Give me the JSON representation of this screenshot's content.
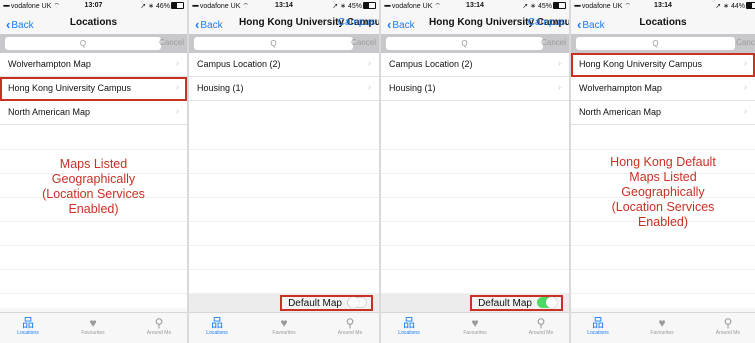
{
  "status_bar": {
    "carrier": "vodafone UK",
    "panels": [
      {
        "time": "13:07",
        "battery": "46%",
        "battery_level": 0.46
      },
      {
        "time": "13:14",
        "battery": "45%",
        "battery_level": 0.45
      },
      {
        "time": "13:14",
        "battery": "45%",
        "battery_level": 0.45
      },
      {
        "time": "13:14",
        "battery": "44%",
        "battery_level": 0.44
      }
    ]
  },
  "nav": {
    "back_label": "Back",
    "locations_title": "Locations",
    "campus_title": "Hong Kong University Campus",
    "campus_right": "Campus"
  },
  "search": {
    "placeholder": "Q",
    "cancel_label": "Cancel"
  },
  "lists": {
    "panel1": [
      "Wolverhampton Map",
      "Hong Kong University Campus",
      "North American Map"
    ],
    "panel2": [
      "Campus Location (2)",
      "Housing (1)"
    ],
    "panel3": [
      "Campus Location (2)",
      "Housing (1)"
    ],
    "panel4": [
      "Hong Kong University Campus",
      "Wolverhampton Map",
      "North American Map"
    ]
  },
  "annotations": {
    "panel1": [
      "Maps Listed",
      "Geographically",
      "(Location Services",
      "Enabled)"
    ],
    "panel4": [
      "Hong Kong Default",
      "Maps Listed",
      "Geographically",
      "(Location Services",
      "Enabled)"
    ]
  },
  "default_map": {
    "label": "Default Map",
    "panel2_on": false,
    "panel3_on": true
  },
  "tabs": {
    "locations": "Locations",
    "favourites": "Favourites",
    "around_me": "Around Me"
  },
  "colors": {
    "accent": "#1a7cf5",
    "highlight": "#c83124",
    "toggle_on": "#4cd964"
  }
}
